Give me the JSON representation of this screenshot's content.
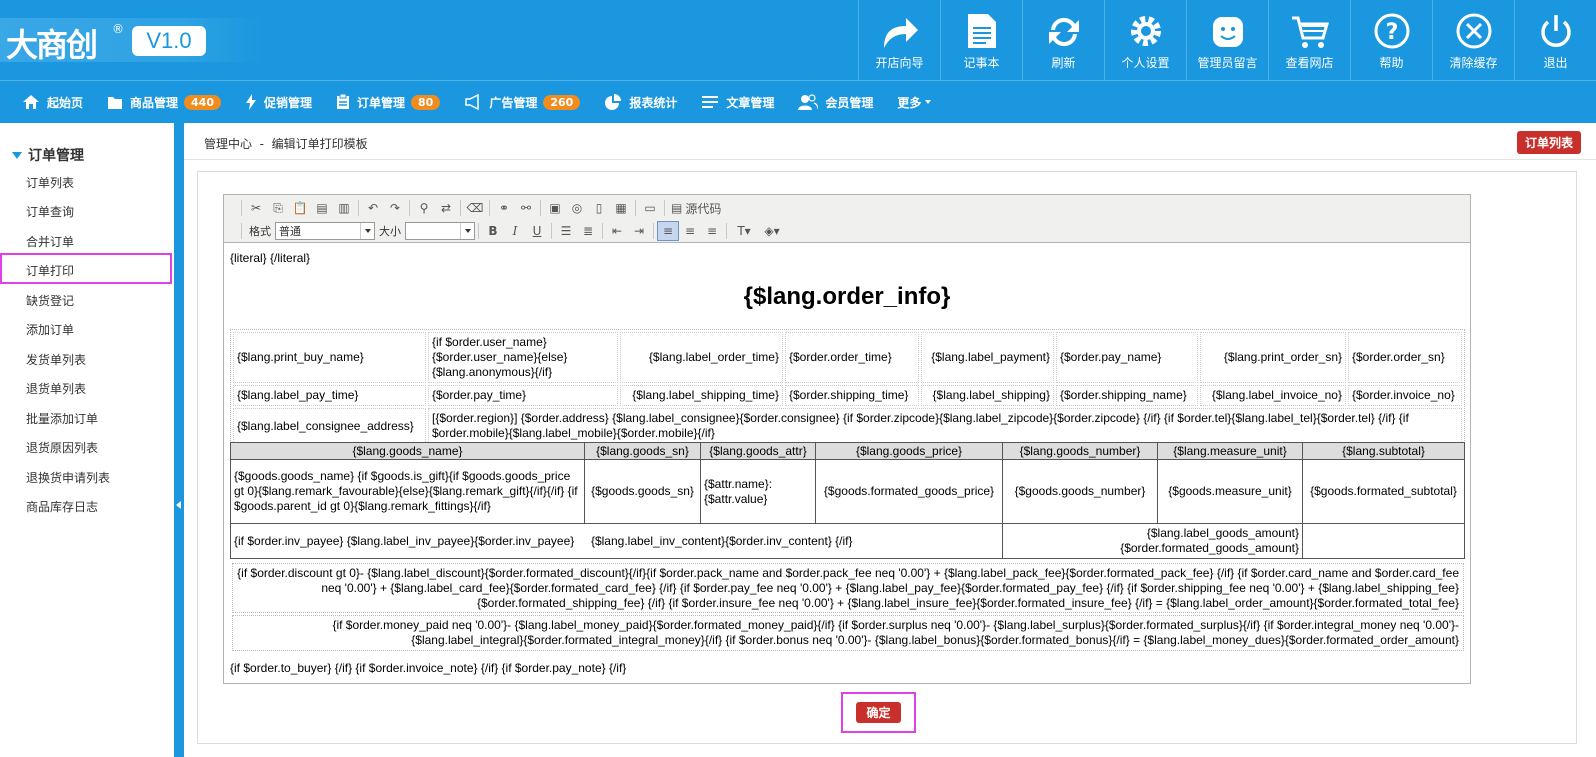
{
  "logo": {
    "text": "大商创",
    "reg": "®",
    "version": "V1.0"
  },
  "top_tools": [
    {
      "label": "开店向导",
      "icon": "share-arrow-icon"
    },
    {
      "label": "记事本",
      "icon": "notepad-icon"
    },
    {
      "label": "刷新",
      "icon": "refresh-icon"
    },
    {
      "label": "个人设置",
      "icon": "gear-icon"
    },
    {
      "label": "管理员留言",
      "icon": "smiley-message-icon"
    },
    {
      "label": "查看网店",
      "icon": "cart-icon"
    },
    {
      "label": "帮助",
      "icon": "help-icon"
    },
    {
      "label": "清除缓存",
      "icon": "clear-icon"
    },
    {
      "label": "退出",
      "icon": "power-icon"
    }
  ],
  "nav": {
    "home": "起始页",
    "goods": "商品管理",
    "goods_count": "440",
    "promo": "促销管理",
    "orders": "订单管理",
    "orders_count": "80",
    "ads": "广告管理",
    "ads_count": "260",
    "stats": "报表统计",
    "articles": "文章管理",
    "members": "会员管理",
    "more": "更多"
  },
  "sidebar": {
    "header": "订单管理",
    "items": [
      "订单列表",
      "订单查询",
      "合并订单",
      "订单打印",
      "缺货登记",
      "添加订单",
      "发货单列表",
      "退货单列表",
      "批量添加订单",
      "退货原因列表",
      "退换货申请列表",
      "商品库存日志"
    ]
  },
  "breadcrumb": {
    "root": "管理中心",
    "sep": "-",
    "current": "编辑订单打印模板"
  },
  "order_list_button": "订单列表",
  "editor_toolbar": {
    "source_label": "源代码",
    "format_label": "格式",
    "format_value": "普通",
    "size_label": "大小",
    "size_value": ""
  },
  "template": {
    "literal": "{literal} {/literal}",
    "title": "{$lang.order_info}",
    "info_rows": [
      [
        "{$lang.print_buy_name}",
        "{if $order.user_name} {$order.user_name}{else} {$lang.anonymous}{/if}",
        "{$lang.label_order_time}",
        "{$order.order_time}",
        "{$lang.label_payment}",
        "{$order.pay_name}",
        "{$lang.print_order_sn}",
        "{$order.order_sn}"
      ],
      [
        "{$lang.label_pay_time}",
        "{$order.pay_time}",
        "{$lang.label_shipping_time}",
        "{$order.shipping_time}",
        "{$lang.label_shipping}",
        "{$order.shipping_name}",
        "{$lang.label_invoice_no}",
        "{$order.invoice_no}"
      ]
    ],
    "consignee_label": "{$lang.label_consignee_address}",
    "consignee_value": "[{$order.region}] {$order.address} {$lang.label_consignee}{$order.consignee} {if $order.zipcode}{$lang.label_zipcode}{$order.zipcode} {/if} {if $order.tel}{$lang.label_tel}{$order.tel} {/if} {if $order.mobile}{$lang.label_mobile}{$order.mobile}{/if}",
    "goods_headers": [
      "{$lang.goods_name}",
      "{$lang.goods_sn}",
      "{$lang.goods_attr}",
      "{$lang.goods_price}",
      "{$lang.goods_number}",
      "{$lang.measure_unit}",
      "{$lang.subtotal}"
    ],
    "goods_row": [
      "{$goods.goods_name} {if $goods.is_gift}{if $goods.goods_price gt 0}{$lang.remark_favourable}{else}{$lang.remark_gift}{/if}{/if} {if $goods.parent_id gt 0}{$lang.remark_fittings}{/if}",
      "{$goods.goods_sn}",
      "{$attr.name}: {$attr.value}",
      "{$goods.formated_goods_price}",
      "{$goods.goods_number}",
      "{$goods.measure_unit}",
      "{$goods.formated_subtotal}"
    ],
    "inv_text": "{if $order.inv_payee} {$lang.label_inv_payee}{$order.inv_payee}     {$lang.label_inv_content}{$order.inv_content} {/if}",
    "goods_amount": "{$lang.label_goods_amount}{$order.formated_goods_amount}",
    "total_line": "{if $order.discount gt 0}- {$lang.label_discount}{$order.formated_discount}{/if}{if $order.pack_name and $order.pack_fee neq '0.00'} + {$lang.label_pack_fee}{$order.formated_pack_fee} {/if} {if $order.card_name and $order.card_fee neq '0.00'} + {$lang.label_card_fee}{$order.formated_card_fee} {/if} {if $order.pay_fee neq '0.00'} + {$lang.label_pay_fee}{$order.formated_pay_fee} {/if} {if $order.shipping_fee neq '0.00'} + {$lang.label_shipping_fee}{$order.formated_shipping_fee} {/if} {if $order.insure_fee neq '0.00'} + {$lang.label_insure_fee}{$order.formated_insure_fee} {/if} = {$lang.label_order_amount}{$order.formated_total_fee}",
    "money_line": "{if $order.money_paid neq '0.00'}- {$lang.label_money_paid}{$order.formated_money_paid}{/if} {if $order.surplus neq '0.00'}- {$lang.label_surplus}{$order.formated_surplus}{/if} {if $order.integral_money neq '0.00'}- {$lang.label_integral}{$order.formated_integral_money}{/if} {if $order.bonus neq '0.00'}- {$lang.label_bonus}{$order.formated_bonus}{/if} = {$lang.label_money_dues}{$order.formated_order_amount}",
    "footnote": "{if $order.to_buyer} {/if} {if $order.invoice_note} {/if} {if $order.pay_note} {/if}"
  },
  "confirm_button": "确定",
  "colors": {
    "primary": "#1a97de",
    "badge": "#f38c1f",
    "danger": "#c9302c",
    "highlight": "#e040e8"
  }
}
